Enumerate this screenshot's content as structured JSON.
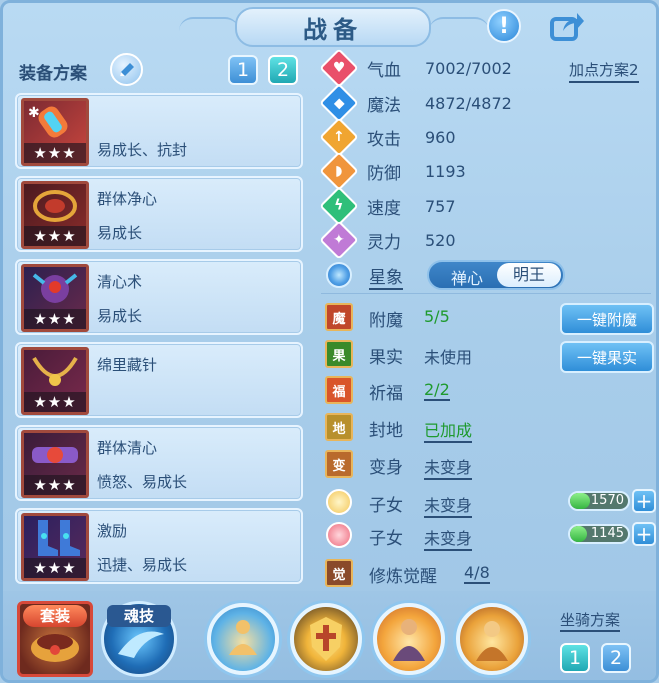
{
  "title": "战备",
  "header": {
    "help_icon": "exclamation-icon",
    "share_icon": "share-icon"
  },
  "equipment": {
    "label": "装备方案",
    "schemes": [
      "1",
      "2"
    ],
    "active_scheme": "2",
    "cards": [
      {
        "name": "",
        "tags": "易成长、抗封",
        "stars": "★★★"
      },
      {
        "name": "群体净心",
        "tags": "易成长",
        "stars": "★★★"
      },
      {
        "name": "清心术",
        "tags": "易成长",
        "stars": "★★★"
      },
      {
        "name": "绵里藏针",
        "tags": "",
        "stars": "★★★"
      },
      {
        "name": "群体清心",
        "tags": "愤怒、易成长",
        "stars": "★★★"
      },
      {
        "name": "激励",
        "tags": "迅捷、易成长",
        "stars": "★★★"
      }
    ]
  },
  "stats": {
    "add_point_scheme": "加点方案2",
    "rows": [
      {
        "label": "气血",
        "value": "7002/7002",
        "color": "#e9506a",
        "glyph": "♥"
      },
      {
        "label": "魔法",
        "value": "4872/4872",
        "color": "#2f8fe6",
        "glyph": "◆"
      },
      {
        "label": "攻击",
        "value": "960",
        "color": "#f0a531",
        "glyph": "↑"
      },
      {
        "label": "防御",
        "value": "1193",
        "color": "#f0953c",
        "glyph": "◗"
      },
      {
        "label": "速度",
        "value": "757",
        "color": "#2fbf7a",
        "glyph": "ϟ"
      },
      {
        "label": "灵力",
        "value": "520",
        "color": "#c07ad6",
        "glyph": "✦"
      }
    ],
    "star_sign": {
      "label": "星象",
      "option_left": "禅心",
      "option_right": "明王",
      "selected": "明王"
    }
  },
  "features": [
    {
      "label": "附魔",
      "value": "5/5",
      "style": "green",
      "icon_bg": "#c0472b",
      "glyph": "魔"
    },
    {
      "label": "果实",
      "value": "未使用",
      "style": "plain",
      "icon_bg": "#3a8a2a",
      "glyph": "果"
    },
    {
      "label": "祈福",
      "value": "2/2",
      "style": "green",
      "icon_bg": "#d9552a",
      "glyph": "福"
    },
    {
      "label": "封地",
      "value": "已加成",
      "style": "green",
      "icon_bg": "#b8902c",
      "glyph": "地"
    },
    {
      "label": "变身",
      "value": "未变身",
      "style": "ul",
      "icon_bg": "#b96a2c",
      "glyph": "变"
    }
  ],
  "children": [
    {
      "label": "子女",
      "value": "未变身",
      "exp": "1570",
      "exp_fraction": 0.35,
      "icon_color": "#f3c75a"
    },
    {
      "label": "子女",
      "value": "未变身",
      "exp": "1145",
      "exp_fraction": 0.3,
      "icon_color": "#ee6a7c"
    }
  ],
  "cultivation": {
    "label": "修炼觉醒",
    "value": "4/8"
  },
  "actions": {
    "enchant": "一键附魔",
    "fruit": "一键果实"
  },
  "bottom": {
    "set_label": "套装",
    "soul_label": "魂技",
    "mount_label": "坐骑方案",
    "mount_schemes": [
      "1",
      "2"
    ],
    "pets": [
      {
        "name": "pet-slot-1",
        "color": "#f2c16a"
      },
      {
        "name": "pet-slot-2",
        "color": "#f0b43a"
      },
      {
        "name": "pet-slot-3",
        "color": "#f3a53c"
      },
      {
        "name": "pet-slot-4",
        "color": "#eaa23a"
      }
    ]
  }
}
